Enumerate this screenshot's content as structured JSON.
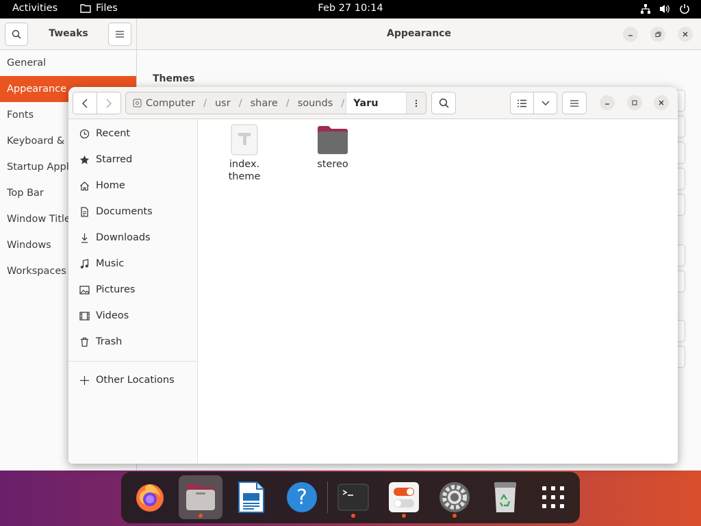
{
  "topbar": {
    "activities": "Activities",
    "app_name": "Files",
    "clock": "Feb 27  10:14"
  },
  "tweaks": {
    "title": "Tweaks",
    "page_title": "Appearance",
    "section_label": "Themes",
    "sidebar": [
      {
        "label": "General",
        "active": false
      },
      {
        "label": "Appearance",
        "active": true
      },
      {
        "label": "Fonts",
        "active": false
      },
      {
        "label": "Keyboard & M",
        "active": false
      },
      {
        "label": "Startup Appli",
        "active": false
      },
      {
        "label": "Top Bar",
        "active": false
      },
      {
        "label": "Window Titleb",
        "active": false
      },
      {
        "label": "Windows",
        "active": false
      },
      {
        "label": "Workspaces",
        "active": false
      }
    ]
  },
  "files": {
    "breadcrumb": {
      "root": "Computer",
      "parts": [
        "usr",
        "share",
        "sounds"
      ],
      "current": "Yaru"
    },
    "sidebar": {
      "places": [
        {
          "label": "Recent",
          "icon": "clock-icon"
        },
        {
          "label": "Starred",
          "icon": "star-icon"
        },
        {
          "label": "Home",
          "icon": "home-icon"
        },
        {
          "label": "Documents",
          "icon": "document-icon"
        },
        {
          "label": "Downloads",
          "icon": "download-icon"
        },
        {
          "label": "Music",
          "icon": "music-icon"
        },
        {
          "label": "Pictures",
          "icon": "picture-icon"
        },
        {
          "label": "Videos",
          "icon": "video-icon"
        },
        {
          "label": "Trash",
          "icon": "trash-icon"
        }
      ],
      "other": "Other Locations"
    },
    "items": [
      {
        "name_line1": "index.",
        "name_line2": "theme",
        "kind": "file"
      },
      {
        "name_line1": "stereo",
        "name_line2": "",
        "kind": "folder"
      }
    ]
  },
  "dock": {
    "apps": [
      "firefox",
      "files",
      "libreoffice-writer",
      "help",
      "terminal",
      "tweaks",
      "settings",
      "trash",
      "show-applications"
    ]
  },
  "colors": {
    "accent": "#e95420",
    "folder": "#6b6b6b",
    "folder_tab": "#9e2c4e"
  }
}
